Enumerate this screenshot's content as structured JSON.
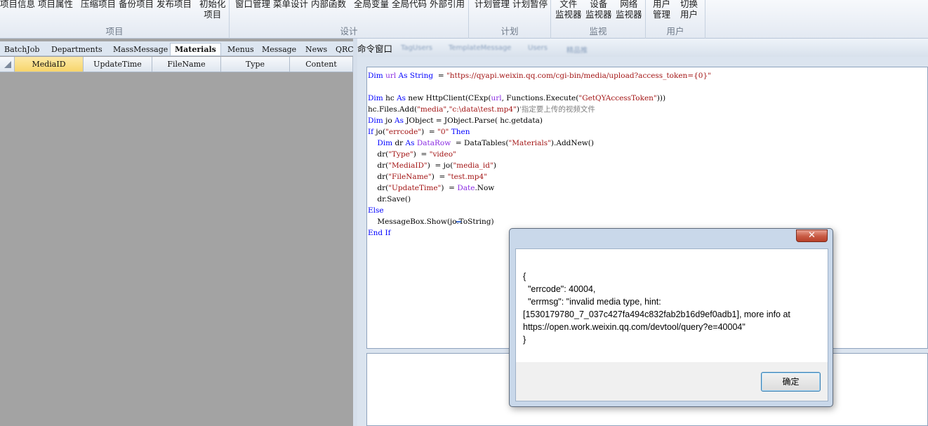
{
  "ribbon": {
    "groups": [
      {
        "label": "项目",
        "buttons": [
          "项目信息",
          "项目属性",
          "压缩项目",
          "备份项目",
          "发布项目",
          "初始化\n项目"
        ]
      },
      {
        "label": "设计",
        "buttons": [
          "窗口管理",
          "菜单设计",
          "内部函数",
          "全局变量",
          "全局代码",
          "外部引用"
        ]
      },
      {
        "label": "计划",
        "buttons": [
          "计划管理",
          "计划暂停"
        ]
      },
      {
        "label": "监视",
        "buttons": [
          "文件\n监视器",
          "设备\n监视器",
          "网络\n监视器"
        ]
      },
      {
        "label": "用户",
        "buttons": [
          "用户\n管理",
          "切换\n用户"
        ]
      }
    ]
  },
  "left": {
    "tabs": [
      "BatchJob",
      "Departments",
      "MassMessage",
      "Materials",
      "Menus",
      "Message",
      "News",
      "QRCo"
    ],
    "active_tab": "Materials",
    "columns": [
      "MediaID",
      "UpdateTime",
      "FileName",
      "Type",
      "Content"
    ]
  },
  "right": {
    "title": "命令窗口",
    "ghost_tabs": [
      "TagUsers",
      "TemplateMessage",
      "Users",
      "精品推"
    ],
    "code_lines": [
      [
        [
          "kw",
          "Dim "
        ],
        [
          "ob",
          "url"
        ],
        [
          "kw",
          " As "
        ],
        [
          "kw",
          "String"
        ],
        [
          "",
          "  = "
        ],
        [
          "st",
          "\"https://qyapi.weixin.qq.com/cgi-bin/media/upload?access_token={0}\""
        ]
      ],
      [],
      [
        [
          "kw",
          "Dim "
        ],
        [
          "",
          "hc "
        ],
        [
          "kw",
          "As "
        ],
        [
          "",
          "new HttpClient(CExp("
        ],
        [
          "ob",
          "url"
        ],
        [
          "",
          ", Functions.Execute("
        ],
        [
          "st",
          "\"GetQYAccessToken\""
        ],
        [
          "",
          ")))"
        ]
      ],
      [
        [
          "",
          "hc.Files.Add("
        ],
        [
          "st",
          "\"media\""
        ],
        [
          "",
          ","
        ],
        [
          "st",
          "\"c:\\data\\test.mp4\""
        ],
        [
          "",
          ")"
        ],
        [
          "cm",
          "'指定要上传的视频文件"
        ]
      ],
      [
        [
          "kw",
          "Dim "
        ],
        [
          "",
          "jo "
        ],
        [
          "kw",
          "As "
        ],
        [
          "",
          "JObject = JObject.Parse( hc.getdata)"
        ]
      ],
      [
        [
          "kw",
          "If "
        ],
        [
          "",
          "jo("
        ],
        [
          "st",
          "\"errcode\""
        ],
        [
          "",
          ")  = "
        ],
        [
          "st",
          "\"0\""
        ],
        [
          "kw",
          " Then"
        ]
      ],
      [
        [
          "",
          "    "
        ],
        [
          "kw",
          "Dim "
        ],
        [
          "",
          "dr "
        ],
        [
          "kw",
          "As "
        ],
        [
          "ty",
          "DataRow"
        ],
        [
          "",
          "  = DataTables("
        ],
        [
          "st",
          "\"Materials\""
        ],
        [
          "",
          ").AddNew()"
        ]
      ],
      [
        [
          "",
          "    dr("
        ],
        [
          "st",
          "\"Type\""
        ],
        [
          "",
          ")  = "
        ],
        [
          "st",
          "\"video\""
        ]
      ],
      [
        [
          "",
          "    dr("
        ],
        [
          "st",
          "\"MediaID\""
        ],
        [
          "",
          ")  = jo("
        ],
        [
          "st",
          "\"media_id\""
        ],
        [
          "",
          ")"
        ]
      ],
      [
        [
          "",
          "    dr("
        ],
        [
          "st",
          "\"FileName\""
        ],
        [
          "",
          ")  = "
        ],
        [
          "st",
          "\"test.mp4\""
        ]
      ],
      [
        [
          "",
          "    dr("
        ],
        [
          "st",
          "\"UpdateTime\""
        ],
        [
          "",
          ")  = "
        ],
        [
          "ty",
          "Date"
        ],
        [
          "",
          ".Now"
        ]
      ],
      [
        [
          "",
          "    dr.Save()"
        ]
      ],
      [
        [
          "kw",
          "Else"
        ]
      ],
      [
        [
          "",
          "    MessageBox.Show(jo.ToString)"
        ]
      ],
      [
        [
          "kw",
          "End If"
        ]
      ]
    ]
  },
  "msgbox": {
    "text": "{\n  \"errcode\": 40004,\n  \"errmsg\": \"invalid media type, hint: [1530179780_7_037c427fa494c832fab2b16d9ef0adb1], more info at https://open.work.weixin.qq.com/devtool/query?e=40004\"\n}",
    "ok_label": "确定",
    "close_label": "✕"
  }
}
